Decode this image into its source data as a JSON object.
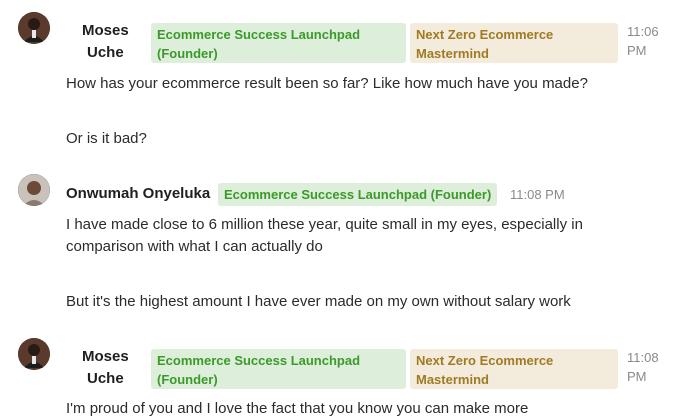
{
  "messages": [
    {
      "author_line1": "Moses",
      "author_line2": "Uche",
      "badge_primary_line1": "Ecommerce Success Launchpad",
      "badge_primary_line2": "(Founder)",
      "badge_secondary_line1": "Next Zero Ecommerce",
      "badge_secondary_line2": "Mastermind",
      "time_line1": "11:06",
      "time_line2": "PM",
      "paragraphs": [
        "How has your ecommerce result been so far? Like how much have you made?",
        "Or is it bad?"
      ]
    },
    {
      "author": "Onwumah Onyeluka",
      "badge_primary": "Ecommerce Success Launchpad (Founder)",
      "time": "11:08 PM",
      "paragraphs": [
        "I have made close to 6 million these year, quite small in my eyes, especially in",
        "comparison with what I can actually do",
        "But it's the highest amount I have ever made on my own without salary work"
      ]
    },
    {
      "author_line1": "Moses",
      "author_line2": "Uche",
      "badge_primary_line1": "Ecommerce Success Launchpad",
      "badge_primary_line2": "(Founder)",
      "badge_secondary_line1": "Next Zero Ecommerce",
      "badge_secondary_line2": "Mastermind",
      "time_line1": "11:08",
      "time_line2": "PM",
      "paragraphs": [
        "I'm proud of you and I love the fact that you know you can make more"
      ]
    }
  ],
  "colors": {
    "badge_green_bg": "#ddeedb",
    "badge_green_text": "#3b9a2a",
    "badge_gold_bg": "#f3ecdc",
    "badge_gold_text": "#a07a24",
    "timestamp": "#8a8a8a"
  }
}
